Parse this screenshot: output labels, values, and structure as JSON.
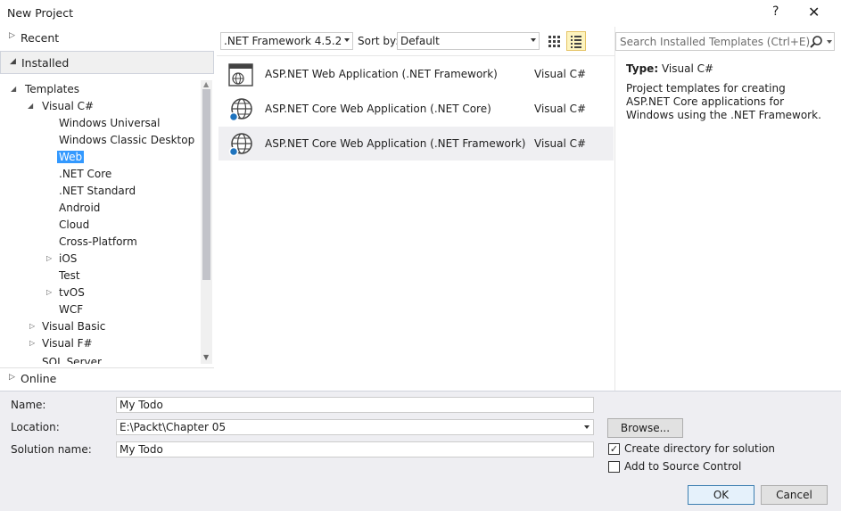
{
  "window": {
    "title": "New Project",
    "help": "?",
    "close": "✕"
  },
  "left": {
    "recent": "Recent",
    "installed": "Installed",
    "online": "Online",
    "tree": [
      {
        "label": "Templates",
        "expander": "◢"
      },
      {
        "label": "Visual C#",
        "expander": "◢"
      },
      {
        "label": "Windows Universal"
      },
      {
        "label": "Windows Classic Desktop"
      },
      {
        "label": "Web"
      },
      {
        "label": ".NET Core"
      },
      {
        "label": ".NET Standard"
      },
      {
        "label": "Android"
      },
      {
        "label": "Cloud"
      },
      {
        "label": "Cross-Platform"
      },
      {
        "label": "iOS",
        "expander": "▷"
      },
      {
        "label": "Test"
      },
      {
        "label": "tvOS",
        "expander": "▷"
      },
      {
        "label": "WCF"
      },
      {
        "label": "Visual Basic",
        "expander": "▷"
      },
      {
        "label": "Visual F#",
        "expander": "▷"
      },
      {
        "label": "SQL Server"
      }
    ]
  },
  "toolbar": {
    "framework": ".NET Framework 4.5.2",
    "sort_label": "Sort by:",
    "sort_value": "Default"
  },
  "templates": [
    {
      "name": "ASP.NET Web Application (.NET Framework)",
      "lang": "Visual C#",
      "icon": "web-app-icon"
    },
    {
      "name": "ASP.NET Core Web Application (.NET Core)",
      "lang": "Visual C#",
      "icon": "globe-icon"
    },
    {
      "name": "ASP.NET Core Web Application (.NET Framework)",
      "lang": "Visual C#",
      "icon": "globe-icon"
    }
  ],
  "right": {
    "search_placeholder": "Search Installed Templates (Ctrl+E)",
    "type_label": "Type:",
    "type_value": "Visual C#",
    "description": "Project templates for creating ASP.NET Core applications for Windows using the .NET Framework."
  },
  "form": {
    "name_label": "Name:",
    "name_value": "My Todo",
    "location_label": "Location:",
    "location_value": "E:\\Packt\\Chapter 05",
    "solution_label": "Solution name:",
    "solution_value": "My Todo",
    "browse": "Browse...",
    "create_dir": "Create directory for solution",
    "create_dir_checked": true,
    "source_control": "Add to Source Control",
    "source_control_checked": false,
    "ok": "OK",
    "cancel": "Cancel"
  },
  "colors": {
    "selection": "#3399ff",
    "accent": "#3c7fb1",
    "bottom_bg": "#eeeef2"
  }
}
